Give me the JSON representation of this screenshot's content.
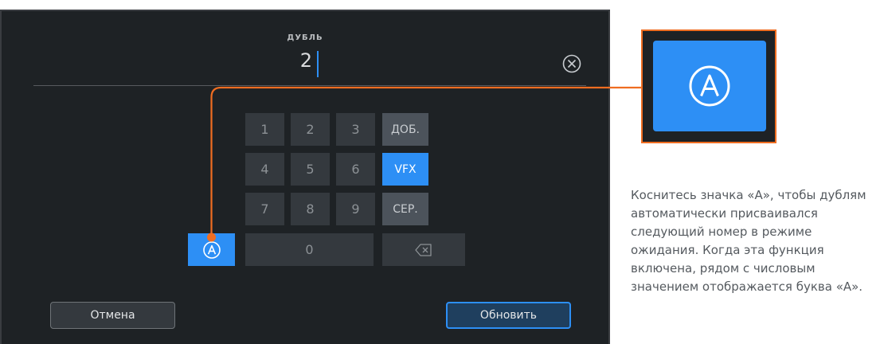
{
  "dialog": {
    "field_label": "ДУБЛЬ",
    "field_value": "2",
    "clear_icon": "circle-x-icon"
  },
  "keypad": {
    "row1": [
      "1",
      "2",
      "3"
    ],
    "row2": [
      "4",
      "5",
      "6"
    ],
    "row3": [
      "7",
      "8",
      "9"
    ],
    "zero": "0",
    "func_keys": [
      "ДОБ.",
      "VFX",
      "СЕР."
    ],
    "active_func": "VFX",
    "auto_icon": "circled-a-icon",
    "backspace_icon": "backspace-icon"
  },
  "buttons": {
    "cancel": "Отмена",
    "update": "Обновить"
  },
  "callout": {
    "zoom_icon": "circled-a-icon",
    "description": "Коснитесь значка «А», чтобы дублям автоматически присваивался следующий номер в режиме ожидания. Когда эта функция включена, рядом с числовым значением отображается буква «А»."
  },
  "colors": {
    "accent_blue": "#2d8ff5",
    "callout_orange": "#ef6d21",
    "screen_bg": "#1e2225"
  }
}
